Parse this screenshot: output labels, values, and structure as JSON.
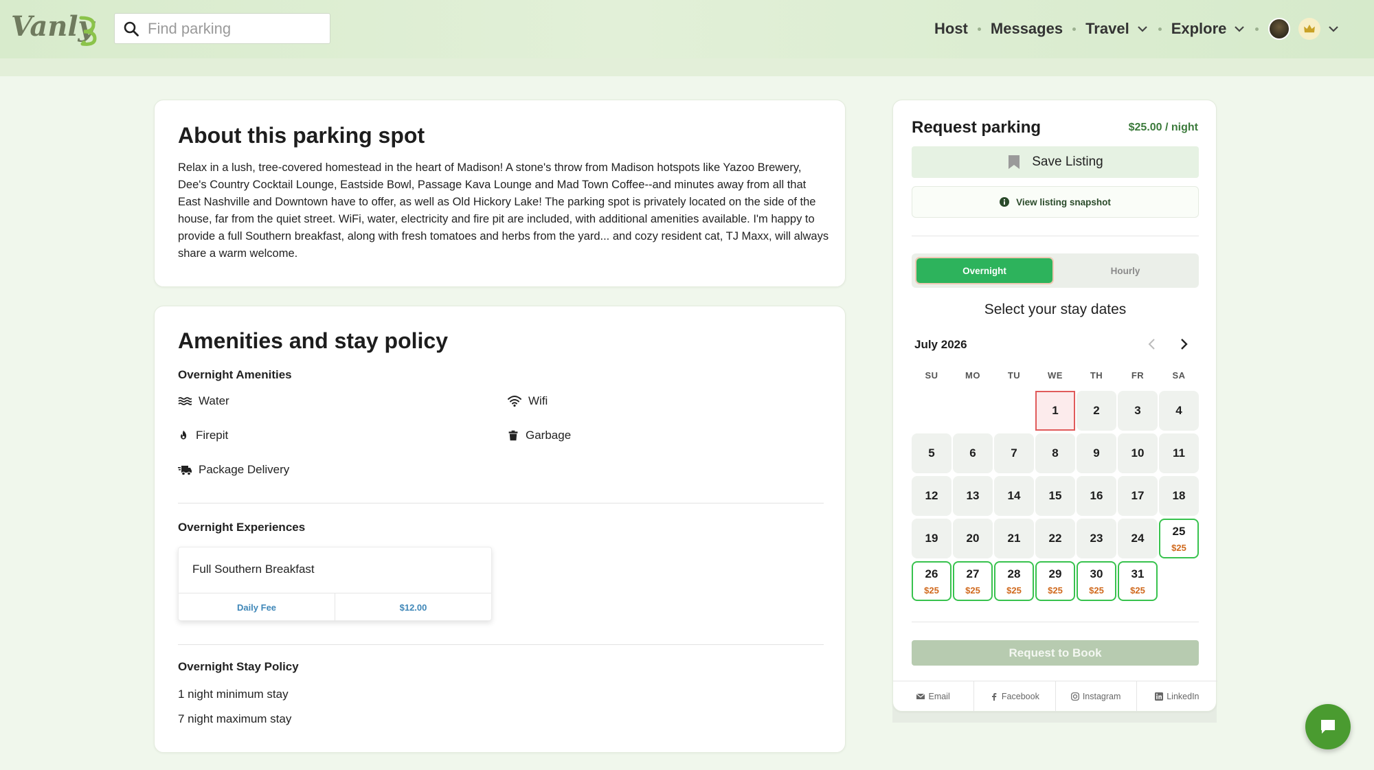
{
  "brand": {
    "name": "Vanly",
    "accent": "#2db35c"
  },
  "search": {
    "placeholder": "Find parking"
  },
  "nav": {
    "host": "Host",
    "messages": "Messages",
    "travel": "Travel",
    "explore": "Explore"
  },
  "about": {
    "title": "About this parking spot",
    "description": "Relax in a lush, tree-covered homestead in the heart of Madison! A stone's throw from Madison hotspots like Yazoo Brewery, Dee's Country Cocktail Lounge, Eastside Bowl, Passage Kava Lounge and Mad Town Coffee--and minutes away from all that East Nashville and Downtown have to offer, as well as Old Hickory Lake! The parking spot is privately located on the side of the house, far from the quiet street. WiFi, water, electricity and fire pit are included, with additional amenities available. I'm happy to provide a full Southern breakfast, along with fresh tomatoes and herbs from the yard... and cozy resident cat, TJ Maxx, will always share a warm welcome."
  },
  "amenities": {
    "title": "Amenities and stay policy",
    "overnight_heading": "Overnight Amenities",
    "items": [
      {
        "label": "Water",
        "icon": "water-icon"
      },
      {
        "label": "Wifi",
        "icon": "wifi-icon"
      },
      {
        "label": "Firepit",
        "icon": "fire-icon"
      },
      {
        "label": "Garbage",
        "icon": "trash-icon"
      },
      {
        "label": "Package Delivery",
        "icon": "truck-icon"
      }
    ],
    "experiences_heading": "Overnight Experiences",
    "experience": {
      "title": "Full Southern Breakfast",
      "fee_label": "Daily Fee",
      "fee_value": "$12.00"
    },
    "policy_heading": "Overnight Stay Policy",
    "policy": [
      "1 night minimum stay",
      "7 night maximum stay"
    ]
  },
  "request": {
    "title": "Request parking",
    "price": "$25.00 / night",
    "save_label": "Save Listing",
    "snapshot_label": "View listing snapshot",
    "toggle": {
      "overnight": "Overnight",
      "hourly": "Hourly",
      "selected": "Overnight"
    },
    "select_dates": "Select your stay dates",
    "month": "July 2026",
    "weekdays": [
      "SU",
      "MO",
      "TU",
      "WE",
      "TH",
      "FR",
      "SA"
    ],
    "first_weekday_index": 3,
    "days_in_month": 31,
    "today": 1,
    "available_days": [
      25,
      26,
      27,
      28,
      29,
      30,
      31
    ],
    "available_price": "$25",
    "book_label": "Request to Book",
    "share": [
      "Email",
      "Facebook",
      "Instagram",
      "LinkedIn"
    ]
  }
}
